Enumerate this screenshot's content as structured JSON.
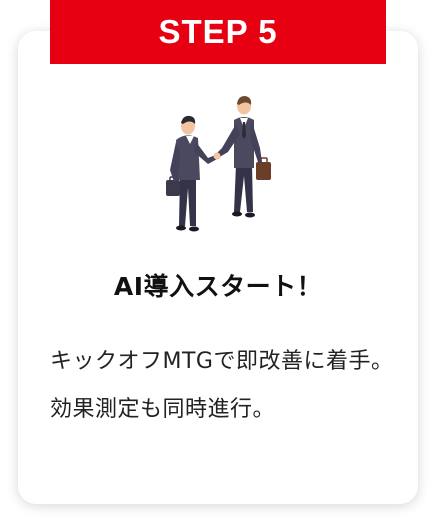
{
  "step": {
    "label": "STEP 5"
  },
  "card": {
    "title": "AI導入スタート！",
    "description": "キックオフMTGで即改善に着手。効果測定も同時進行。"
  },
  "illustration": {
    "icon": "handshake-businessmen-illustration"
  },
  "colors": {
    "accent": "#e60012",
    "text": "#111111",
    "card_bg": "#ffffff"
  }
}
